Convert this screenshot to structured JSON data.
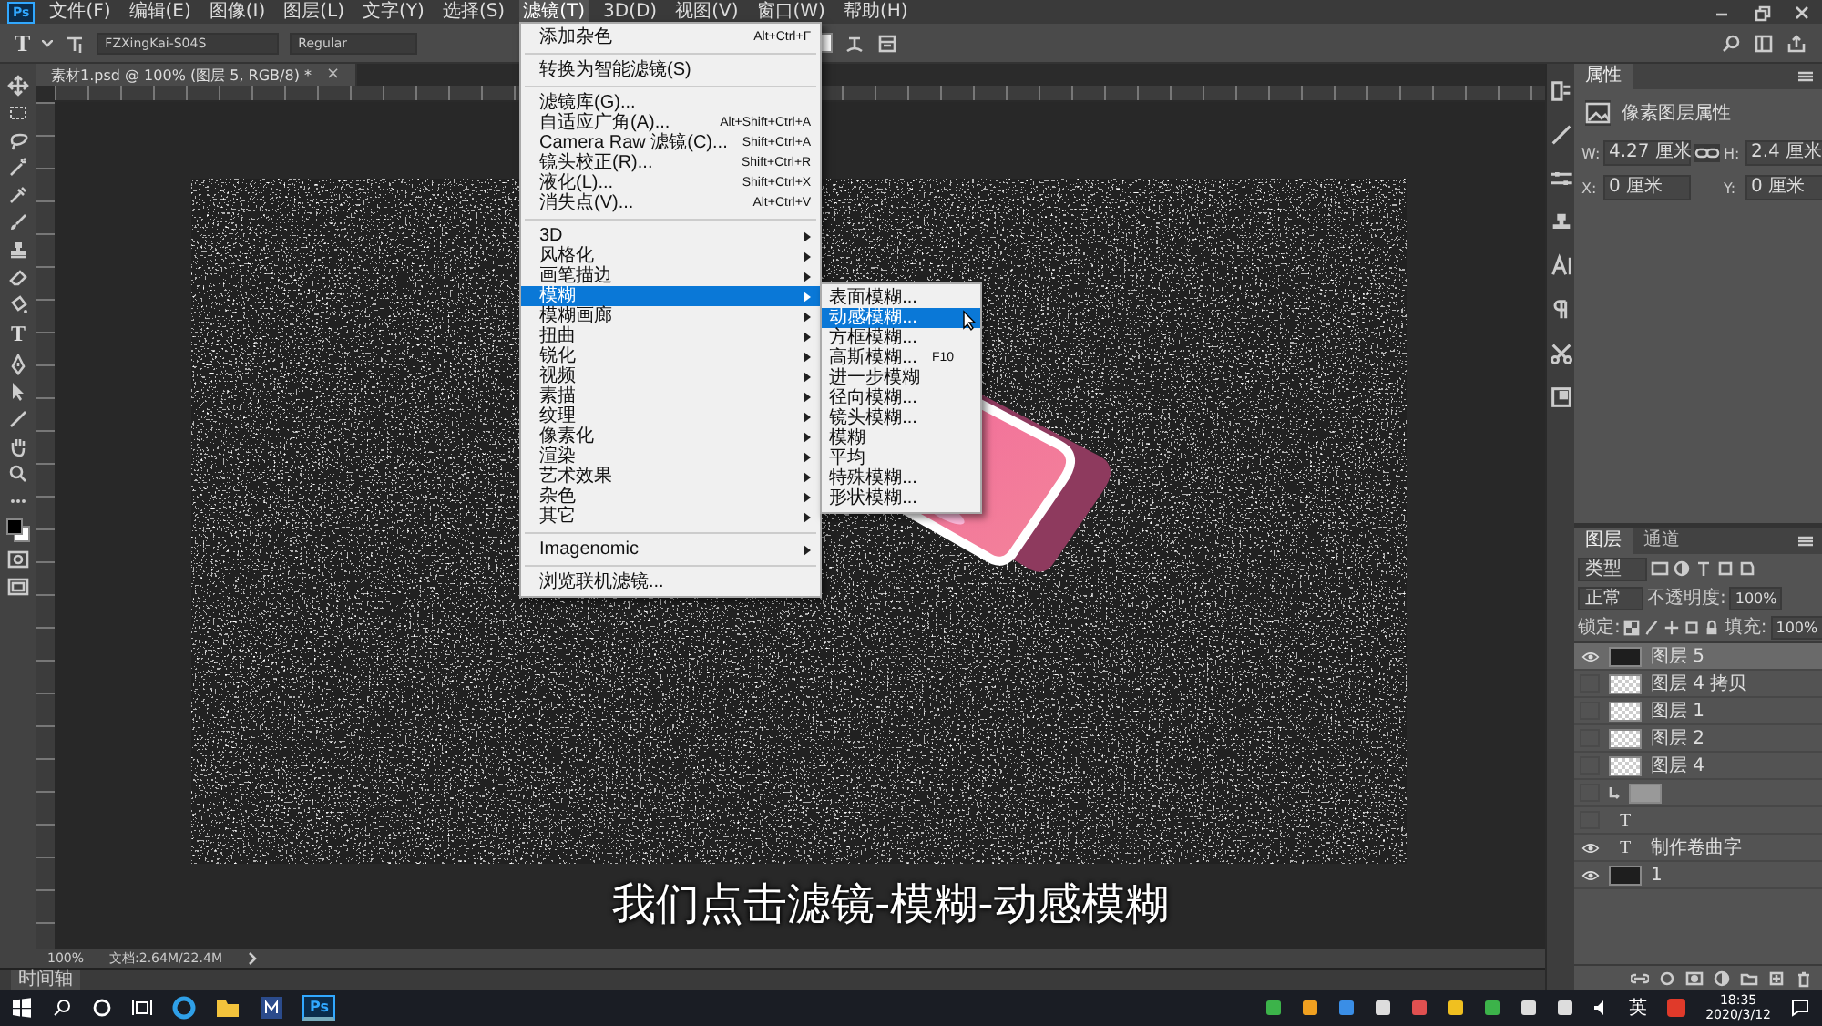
{
  "menu_bar": {
    "logo": "Ps",
    "items": [
      {
        "label": "文件(F)",
        "selected": false
      },
      {
        "label": "编辑(E)",
        "selected": false
      },
      {
        "label": "图像(I)",
        "selected": false
      },
      {
        "label": "图层(L)",
        "selected": false
      },
      {
        "label": "文字(Y)",
        "selected": false
      },
      {
        "label": "选择(S)",
        "selected": false
      },
      {
        "label": "滤镜(T)",
        "selected": true
      },
      {
        "label": "3D(D)",
        "selected": false
      },
      {
        "label": "视图(V)",
        "selected": false
      },
      {
        "label": "窗口(W)",
        "selected": false
      },
      {
        "label": "帮助(H)",
        "selected": false
      }
    ]
  },
  "options_bar": {
    "tool": "T",
    "font": "FZXingKai-S04S",
    "style": "Regular"
  },
  "toolbar": {
    "text_tool": "T"
  },
  "document_tab": {
    "title": "素材1.psd @ 100% (图层 5, RGB/8) *",
    "close": "×"
  },
  "filter_menu": {
    "groups": [
      [
        {
          "label": "添加杂色",
          "shortcut": "Alt+Ctrl+F",
          "submenu": false,
          "selected": false
        }
      ],
      [
        {
          "label": "转换为智能滤镜(S)",
          "submenu": false,
          "selected": false
        }
      ],
      [
        {
          "label": "滤镜库(G)...",
          "submenu": false,
          "selected": false
        },
        {
          "label": "自适应广角(A)...",
          "shortcut": "Alt+Shift+Ctrl+A",
          "submenu": false,
          "selected": false
        },
        {
          "label": "Camera Raw 滤镜(C)...",
          "shortcut": "Shift+Ctrl+A",
          "submenu": false,
          "selected": false
        },
        {
          "label": "镜头校正(R)...",
          "shortcut": "Shift+Ctrl+R",
          "submenu": false,
          "selected": false
        },
        {
          "label": "液化(L)...",
          "shortcut": "Shift+Ctrl+X",
          "submenu": false,
          "selected": false
        },
        {
          "label": "消失点(V)...",
          "shortcut": "Alt+Ctrl+V",
          "submenu": false,
          "selected": false
        }
      ],
      [
        {
          "label": "3D",
          "submenu": true,
          "selected": false
        },
        {
          "label": "风格化",
          "submenu": true,
          "selected": false
        },
        {
          "label": "画笔描边",
          "submenu": true,
          "selected": false
        },
        {
          "label": "模糊",
          "submenu": true,
          "selected": true
        },
        {
          "label": "模糊画廊",
          "submenu": true,
          "selected": false
        },
        {
          "label": "扭曲",
          "submenu": true,
          "selected": false
        },
        {
          "label": "锐化",
          "submenu": true,
          "selected": false
        },
        {
          "label": "视频",
          "submenu": true,
          "selected": false
        },
        {
          "label": "素描",
          "submenu": true,
          "selected": false
        },
        {
          "label": "纹理",
          "submenu": true,
          "selected": false
        },
        {
          "label": "像素化",
          "submenu": true,
          "selected": false
        },
        {
          "label": "渲染",
          "submenu": true,
          "selected": false
        },
        {
          "label": "艺术效果",
          "submenu": true,
          "selected": false
        },
        {
          "label": "杂色",
          "submenu": true,
          "selected": false
        },
        {
          "label": "其它",
          "submenu": true,
          "selected": false
        }
      ],
      [
        {
          "label": "Imagenomic",
          "submenu": true,
          "selected": false
        }
      ],
      [
        {
          "label": "浏览联机滤镜...",
          "submenu": false,
          "selected": false
        }
      ]
    ]
  },
  "blur_submenu": {
    "items": [
      {
        "label": "表面模糊...",
        "selected": false
      },
      {
        "label": "动感模糊...",
        "selected": true
      },
      {
        "label": "方框模糊...",
        "selected": false
      },
      {
        "label": "高斯模糊...",
        "shortcut": "F10",
        "selected": false
      },
      {
        "label": "进一步模糊",
        "selected": false
      },
      {
        "label": "径向模糊...",
        "selected": false
      },
      {
        "label": "镜头模糊...",
        "selected": false
      },
      {
        "label": "模糊",
        "selected": false
      },
      {
        "label": "平均",
        "selected": false
      },
      {
        "label": "特殊模糊...",
        "selected": false
      },
      {
        "label": "形状模糊...",
        "selected": false
      }
    ]
  },
  "caption": "我们点击滤镜-模糊-动感模糊",
  "status_bar": {
    "zoom": "100%",
    "doc_size": "文档:2.64M/22.4M"
  },
  "timeline": {
    "label": "时间轴"
  },
  "properties_panel": {
    "tab": "属性",
    "heading": "像素图层属性",
    "fields": [
      {
        "label": "W:",
        "value": "4.27 厘米"
      },
      {
        "label": "H:",
        "value": "2.4 厘米"
      },
      {
        "label": "X:",
        "value": "0 厘米"
      },
      {
        "label": "Y:",
        "value": "0 厘米"
      }
    ]
  },
  "layers_panel": {
    "tabs": [
      {
        "label": "图层",
        "selected": true
      },
      {
        "label": "通道",
        "selected": false
      }
    ],
    "filter": "类型",
    "blend_mode": "正常",
    "opacity_label": "不透明度:",
    "opacity": "100%",
    "lock_label": "锁定:",
    "fill_label": "填充:",
    "fill": "100%",
    "layers": [
      {
        "kind": "noise",
        "name": "图层 5",
        "visible": true,
        "selected": true
      },
      {
        "kind": "pixel",
        "name": "图层 4 拷贝",
        "visible": false,
        "selected": false
      },
      {
        "kind": "pixel",
        "name": "图层 1",
        "visible": false,
        "selected": false
      },
      {
        "kind": "pixel",
        "name": "图层 2",
        "visible": false,
        "selected": false
      },
      {
        "kind": "pixel",
        "name": "图层 4",
        "visible": false,
        "selected": false
      },
      {
        "kind": "clipped",
        "visible": false,
        "selected": false
      },
      {
        "kind": "text",
        "icon": "T",
        "visible": false,
        "selected": false
      },
      {
        "kind": "text",
        "icon": "T",
        "name": "制作卷曲字",
        "visible": true,
        "selected": false
      },
      {
        "kind": "noise",
        "name": "1",
        "visible": true,
        "selected": false
      }
    ]
  },
  "taskbar": {
    "app": "Ps",
    "language": "英",
    "time": "18:35",
    "date": "2020/3/12"
  }
}
